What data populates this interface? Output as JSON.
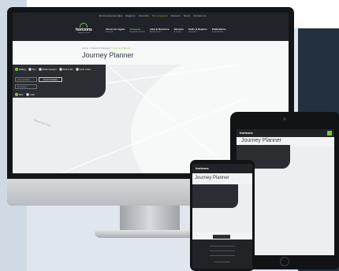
{
  "site": {
    "logo_name": "horizons",
    "logo_tagline": "regional council",
    "top_nav": [
      "Environmental data",
      "Regions",
      "Councils",
      "Our progress",
      "Careers",
      "News",
      "Contact us"
    ],
    "main_nav": [
      {
        "title": "About our region",
        "sub": "& council"
      },
      {
        "title": "Transport",
        "sub": "Regional transport"
      },
      {
        "title": "Land & Resource",
        "sub": "Management"
      },
      {
        "title": "Services",
        "sub": "& pricing"
      },
      {
        "title": "Parks & Regions",
        "sub": "Recreation"
      },
      {
        "title": "Publications",
        "sub": "Consultations"
      }
    ],
    "breadcrumb": [
      "Home",
      "Travel & Transport",
      "Journey Planner"
    ],
    "page_title": "Journey Planner"
  },
  "planner": {
    "modes": [
      "Walking",
      "Bus",
      "Public transport",
      "Park & ride",
      "Cycle routes"
    ],
    "from_placeholder": "From location",
    "to_placeholder": "To location",
    "current_location_button": "Current location",
    "options": [
      "Now",
      "Later"
    ]
  },
  "map": {
    "place_label": "Palmerston North"
  },
  "colors": {
    "accent": "#7ec443",
    "dark": "#202428",
    "panel": "#2a2d31",
    "navy": "#23313f"
  }
}
